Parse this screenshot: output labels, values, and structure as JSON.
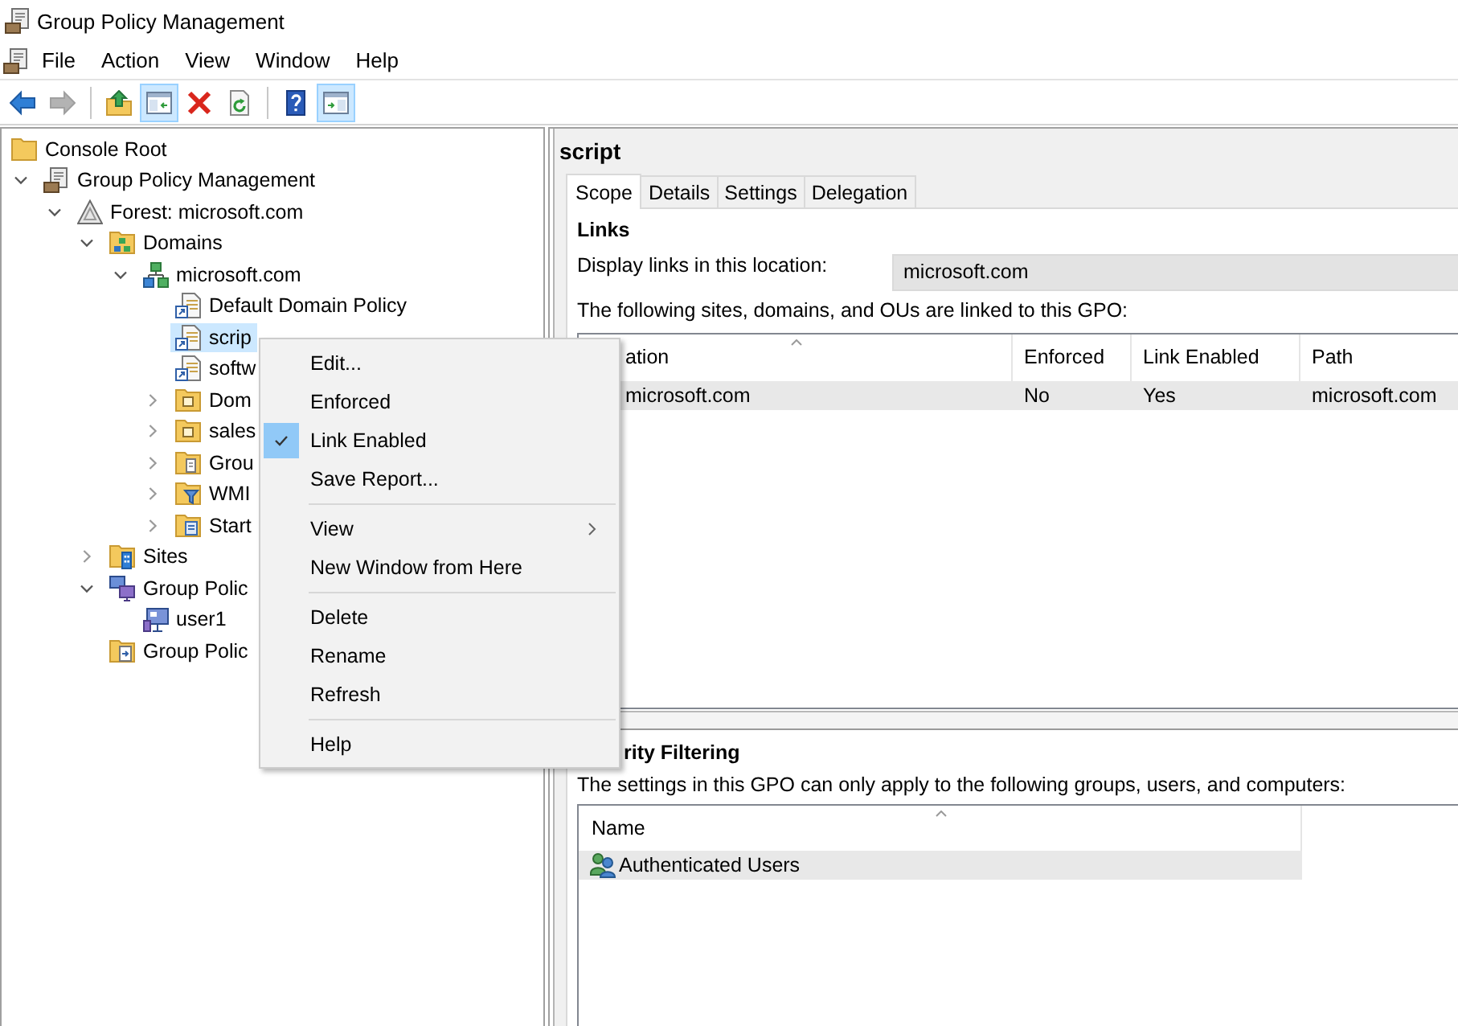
{
  "window": {
    "title": "Group Policy Management"
  },
  "menu_bar": {
    "items": [
      "File",
      "Action",
      "View",
      "Window",
      "Help"
    ]
  },
  "toolbar": {
    "groups": [
      [
        {
          "kind": "back",
          "pressed": false,
          "disabled": false
        },
        {
          "kind": "forward",
          "pressed": false,
          "disabled": true
        }
      ],
      [
        {
          "kind": "up",
          "pressed": false,
          "disabled": false
        },
        {
          "kind": "tree",
          "pressed": true,
          "disabled": false
        },
        {
          "kind": "delete",
          "pressed": false,
          "disabled": false
        },
        {
          "kind": "refresh",
          "pressed": false,
          "disabled": false
        }
      ],
      [
        {
          "kind": "help",
          "pressed": false,
          "disabled": false
        },
        {
          "kind": "actions",
          "pressed": true,
          "disabled": false
        }
      ]
    ]
  },
  "tree": {
    "items": [
      {
        "label": "Console Root",
        "kind": "folder",
        "selected": false,
        "children": [
          {
            "label": "Group Policy Management",
            "kind": "console",
            "expanded": true,
            "selected": false,
            "children": [
              {
                "label": "Forest: microsoft.com",
                "kind": "forest",
                "expanded": true,
                "selected": false,
                "children": [
                  {
                    "label": "Domains",
                    "kind": "domains",
                    "expanded": true,
                    "selected": false,
                    "children": [
                      {
                        "label": "microsoft.com",
                        "kind": "domain",
                        "expanded": true,
                        "selected": false,
                        "children": [
                          {
                            "label": "Default Domain Policy",
                            "kind": "gpo",
                            "selected": false
                          },
                          {
                            "label": "scrip",
                            "kind": "gpo",
                            "selected": true
                          },
                          {
                            "label": "softw",
                            "kind": "gpo",
                            "selected": false
                          },
                          {
                            "label": "Dom",
                            "kind": "ou",
                            "expanded": false,
                            "selected": false
                          },
                          {
                            "label": "sales",
                            "kind": "ou",
                            "expanded": false,
                            "selected": false
                          },
                          {
                            "label": "Grou",
                            "kind": "objects",
                            "expanded": false,
                            "selected": false
                          },
                          {
                            "label": "WMI",
                            "kind": "wmi",
                            "expanded": false,
                            "selected": false
                          },
                          {
                            "label": "Start",
                            "kind": "starter",
                            "expanded": false,
                            "selected": false
                          }
                        ]
                      }
                    ]
                  },
                  {
                    "label": "Sites",
                    "kind": "sites",
                    "expanded": false,
                    "selected": false
                  },
                  {
                    "label": "Group Polic",
                    "kind": "modeling",
                    "expanded": true,
                    "selected": false,
                    "children": [
                      {
                        "label": "user1",
                        "kind": "query",
                        "selected": false
                      }
                    ]
                  },
                  {
                    "label": "Group Polic",
                    "kind": "results",
                    "selected": false
                  }
                ]
              }
            ]
          }
        ]
      }
    ]
  },
  "details": {
    "title": "script",
    "tabs": [
      {
        "label": "Scope",
        "selected": true
      },
      {
        "label": "Details",
        "selected": false
      },
      {
        "label": "Settings",
        "selected": false
      },
      {
        "label": "Delegation",
        "selected": false
      }
    ],
    "links": {
      "heading": "Links",
      "location_label": "Display links in this location:",
      "location_value": "microsoft.com",
      "description": "The following sites, domains, and OUs are linked to this GPO:",
      "table": {
        "columns": [
          {
            "label": "ation",
            "sorted": true
          },
          {
            "label": "Enforced",
            "sorted": false
          },
          {
            "label": "Link Enabled",
            "sorted": false
          },
          {
            "label": "Path",
            "sorted": false
          }
        ],
        "rows": [
          {
            "cells": [
              "microsoft.com",
              "No",
              "Yes",
              "microsoft.com"
            ],
            "selected": true
          }
        ]
      }
    },
    "security_filtering": {
      "heading": "rity Filtering",
      "description": "The settings in this GPO can only apply to the following groups, users, and computers:",
      "list": {
        "columns": [
          {
            "label": "Name",
            "sorted": true
          }
        ],
        "rows": [
          {
            "name": "Authenticated Users",
            "selected": true
          }
        ]
      }
    }
  },
  "context_menu": {
    "groups": [
      [
        {
          "label": "Edit...",
          "checked": false,
          "submenu": false
        },
        {
          "label": "Enforced",
          "checked": false,
          "submenu": false
        },
        {
          "label": "Link Enabled",
          "checked": true,
          "submenu": false
        },
        {
          "label": "Save Report...",
          "checked": false,
          "submenu": false
        }
      ],
      [
        {
          "label": "View",
          "checked": false,
          "submenu": true
        },
        {
          "label": "New Window from Here",
          "checked": false,
          "submenu": false
        }
      ],
      [
        {
          "label": "Delete",
          "checked": false,
          "submenu": false
        },
        {
          "label": "Rename",
          "checked": false,
          "submenu": false
        },
        {
          "label": "Refresh",
          "checked": false,
          "submenu": false
        }
      ],
      [
        {
          "label": "Help",
          "checked": false,
          "submenu": false
        }
      ]
    ]
  }
}
